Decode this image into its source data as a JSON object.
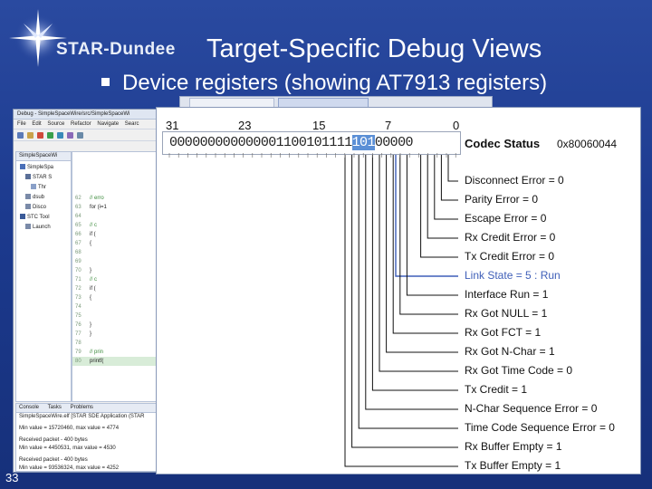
{
  "brand": {
    "logo_text": "STAR-Dundee"
  },
  "slide": {
    "title": "Target-Specific Debug Views",
    "bullet": "Device registers (showing AT7913 registers)",
    "number": "33"
  },
  "ide": {
    "title": "Debug - SimpleSpaceWire/src/SimpleSpaceWi",
    "menu": [
      "File",
      "Edit",
      "Source",
      "Refactor",
      "Navigate",
      "Searc"
    ],
    "tree_tab": "SimpleSpaceWi",
    "tree_items": [
      "SimpleSpa",
      "STAR S",
      "Thr",
      "dsub",
      "Disco",
      "STC Tool",
      "Launch"
    ],
    "editor_lines": [
      {
        "n": "62",
        "t": "// erro",
        "c": "green"
      },
      {
        "n": "63",
        "t": "for (i=1",
        "c": ""
      },
      {
        "n": "64",
        "t": "",
        "c": ""
      },
      {
        "n": "65",
        "t": "// c",
        "c": "green"
      },
      {
        "n": "66",
        "t": "if (",
        "c": ""
      },
      {
        "n": "67",
        "t": "{",
        "c": ""
      },
      {
        "n": "68",
        "t": "",
        "c": ""
      },
      {
        "n": "69",
        "t": "",
        "c": ""
      },
      {
        "n": "70",
        "t": "}",
        "c": ""
      },
      {
        "n": "71",
        "t": "// c",
        "c": "green"
      },
      {
        "n": "72",
        "t": "if (",
        "c": ""
      },
      {
        "n": "73",
        "t": "{",
        "c": ""
      },
      {
        "n": "74",
        "t": "",
        "c": ""
      },
      {
        "n": "75",
        "t": "",
        "c": ""
      },
      {
        "n": "76",
        "t": "}",
        "c": ""
      },
      {
        "n": "77",
        "t": "}",
        "c": ""
      },
      {
        "n": "78",
        "t": "",
        "c": ""
      },
      {
        "n": "79",
        "t": "// prin",
        "c": "green"
      },
      {
        "n": "80",
        "t": "printf(",
        "c": ""
      }
    ],
    "console_tabs": [
      "Console",
      "Tasks",
      "Problems"
    ],
    "console_lines": [
      "SimpleSpaceWire.elf [STAR SDE Application (STAR",
      "",
      "Min value = 15720460, max value = 4774",
      "",
      "Received packet - 400 bytes",
      "Min value = 4450531, max value = 4530",
      "",
      "Received packet - 400 bytes",
      "Min value = 93536324, max value = 4252",
      "",
      "Received packet - 400 bytes"
    ]
  },
  "register": {
    "bit_labels": [
      "31",
      "23",
      "15",
      "7",
      "0"
    ],
    "bits_pre": "000000000000001100101111",
    "bits_highlight": "101",
    "bits_post": "00000",
    "name": "Codec Status",
    "value": "0x80060044",
    "fields": [
      "Disconnect Error = 0",
      "Parity Error = 0",
      "Escape Error = 0",
      "Rx Credit Error = 0",
      "Tx Credit Error = 0",
      "Link State = 5 : Run",
      "Interface Run = 1",
      "Rx Got NULL = 1",
      "Rx Got FCT = 1",
      "Rx Got N-Char = 1",
      "Rx Got Time Code = 0",
      "Tx Credit = 1",
      "N-Char Sequence Error = 0",
      "Time Code Sequence Error = 0",
      "Rx Buffer Empty = 1",
      "Tx Buffer Empty = 1"
    ],
    "selected_field": 5
  },
  "colors": {
    "background": "#1c3a8e",
    "highlight": "#5b8fd6",
    "selected_text": "#3f5fb8"
  }
}
